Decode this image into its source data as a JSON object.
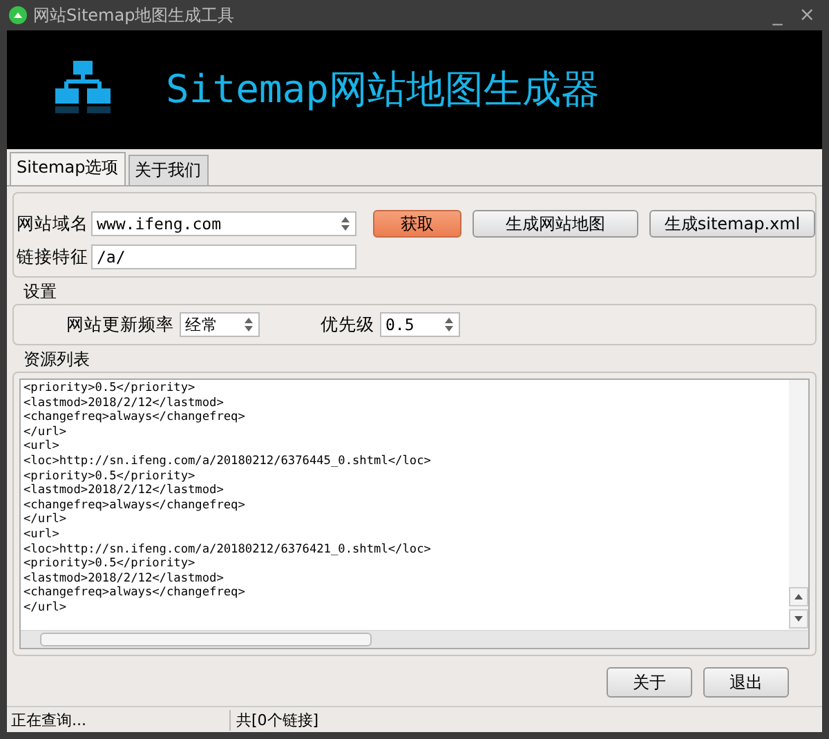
{
  "window": {
    "title": "网站Sitemap地图生成工具",
    "controls": [
      "_",
      "×"
    ]
  },
  "banner": {
    "title": "Sitemap网站地图生成器"
  },
  "tabs": [
    {
      "label": "Sitemap选项",
      "selected": true
    },
    {
      "label": "关于我们",
      "selected": false
    }
  ],
  "domain": {
    "label": "网站域名",
    "value": "www.ifeng.com"
  },
  "pattern": {
    "label": "链接特征",
    "value": "/a/"
  },
  "actions": [
    {
      "label": "获取",
      "kind": "primary"
    },
    {
      "label": "生成网站地图",
      "kind": "normal"
    },
    {
      "label": "生成sitemap.xml",
      "kind": "normal"
    }
  ],
  "settings": {
    "title": "设置",
    "frequency": {
      "label": "网站更新频率",
      "value": "经常"
    },
    "priority": {
      "label": "优先级",
      "value": "0.5"
    }
  },
  "resources": {
    "title": "资源列表",
    "lines": [
      "<priority>0.5</priority>",
      "<lastmod>2018/2/12</lastmod>",
      "<changefreq>always</changefreq>",
      "</url>",
      "<url>",
      "<loc>http://sn.ifeng.com/a/20180212/6376445_0.shtml</loc>",
      "<priority>0.5</priority>",
      "<lastmod>2018/2/12</lastmod>",
      "<changefreq>always</changefreq>",
      "</url>",
      "<url>",
      "<loc>http://sn.ifeng.com/a/20180212/6376421_0.shtml</loc>",
      "<priority>0.5</priority>",
      "<lastmod>2018/2/12</lastmod>",
      "<changefreq>always</changefreq>",
      "</url>"
    ]
  },
  "buttons": [
    "关于",
    "退出"
  ],
  "status_bar": [
    "正在查询...",
    "共[0个链接]"
  ]
}
